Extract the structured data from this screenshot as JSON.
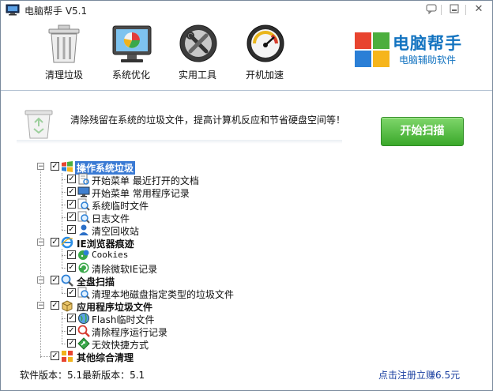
{
  "window": {
    "title": "电脑帮手 V5.1"
  },
  "toolbar": {
    "items": [
      {
        "label": "清理垃圾",
        "icon": "trash-can-icon"
      },
      {
        "label": "系统优化",
        "icon": "monitor-chart-icon"
      },
      {
        "label": "实用工具",
        "icon": "tools-icon"
      },
      {
        "label": "开机加速",
        "icon": "speedometer-icon"
      }
    ]
  },
  "brand": {
    "name": "电脑帮手",
    "subtitle": "电脑辅助软件"
  },
  "banner": {
    "text": "清除残留在系统的垃圾文件，提高计算机反应和节省硬盘空间等！",
    "scan_label": "开始扫描"
  },
  "tree": {
    "groups": [
      {
        "label": "操作系统垃圾",
        "icon": "windows-logo-icon",
        "checked": true,
        "selected": true,
        "children": [
          {
            "label": "开始菜单 最近打开的文档",
            "icon": "document-search-icon",
            "checked": true
          },
          {
            "label": "开始菜单 常用程序记录",
            "icon": "monitor-icon",
            "checked": true
          },
          {
            "label": "系统临时文件",
            "icon": "magnifier-icon",
            "checked": true
          },
          {
            "label": "日志文件",
            "icon": "magnifier-icon",
            "checked": true
          },
          {
            "label": "清空回收站",
            "icon": "user-icon",
            "checked": true
          }
        ]
      },
      {
        "label": "IE浏览器痕迹",
        "icon": "ie-icon",
        "checked": true,
        "selected": false,
        "children": [
          {
            "label": "Cookies",
            "icon": "cookie-icon",
            "checked": true
          },
          {
            "label": "清除微软IE记录",
            "icon": "ie-history-icon",
            "checked": true
          }
        ]
      },
      {
        "label": "全盘扫描",
        "icon": "magnifier-icon",
        "checked": true,
        "selected": false,
        "children": [
          {
            "label": "清理本地磁盘指定类型的垃圾文件",
            "icon": "magnifier-icon",
            "checked": true
          }
        ]
      },
      {
        "label": "应用程序垃圾文件",
        "icon": "package-icon",
        "checked": true,
        "selected": false,
        "children": [
          {
            "label": "Flash临时文件",
            "icon": "globe-icon",
            "checked": true
          },
          {
            "label": "清除程序运行记录",
            "icon": "search-red-icon",
            "checked": true
          },
          {
            "label": "无效快捷方式",
            "icon": "shortcut-icon",
            "checked": true
          }
        ]
      },
      {
        "label": "其他综合清理",
        "icon": "grid-icon",
        "checked": true,
        "selected": false,
        "children": []
      }
    ]
  },
  "footer": {
    "version": "软件版本：5.1最新版本：5.1",
    "register": "点击注册立赚6.5元"
  },
  "colors": {
    "accent": "#1273c0",
    "scan_button": "#3aa82a",
    "selection": "#3a7ad4",
    "link": "#1a3fa0"
  }
}
